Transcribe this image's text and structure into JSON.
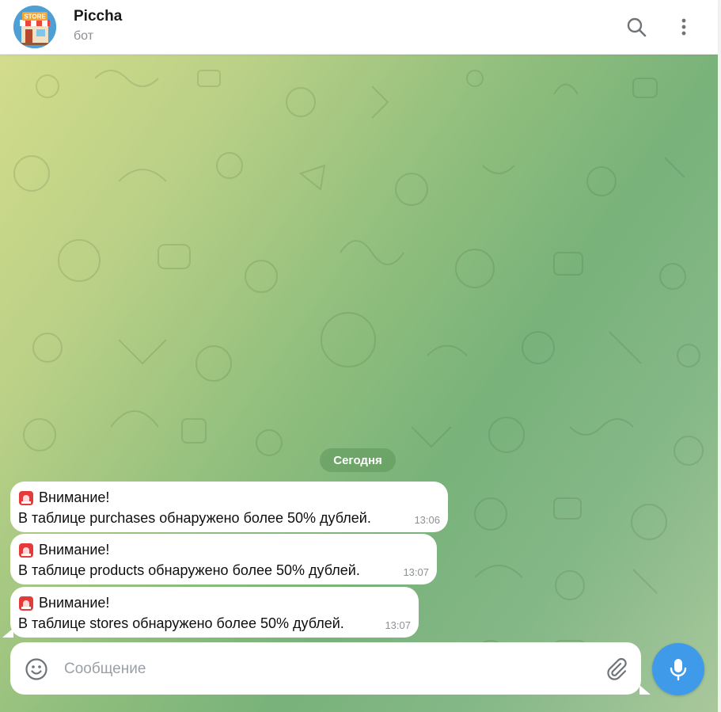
{
  "header": {
    "title": "Piccha",
    "subtitle": "бот",
    "avatar_text": "STORE"
  },
  "chat": {
    "date_label": "Сегодня",
    "messages": [
      {
        "heading": "Внимание!",
        "text": "В таблице purchases обнаружено более 50% дублей.",
        "time": "13:06"
      },
      {
        "heading": "Внимание!",
        "text": "В таблице products обнаружено более 50% дублей.",
        "time": "13:07"
      },
      {
        "heading": "Внимание!",
        "text": "В таблице stores обнаружено более 50% дублей.",
        "time": "13:07"
      }
    ]
  },
  "composer": {
    "placeholder": "Сообщение"
  },
  "colors": {
    "accent": "#3f9bea",
    "bubble": "#ffffff",
    "date_pill": "#5c965a"
  },
  "icons": [
    "search-icon",
    "more-vertical-icon",
    "siren-icon",
    "emoji-icon",
    "paperclip-icon",
    "microphone-icon"
  ]
}
